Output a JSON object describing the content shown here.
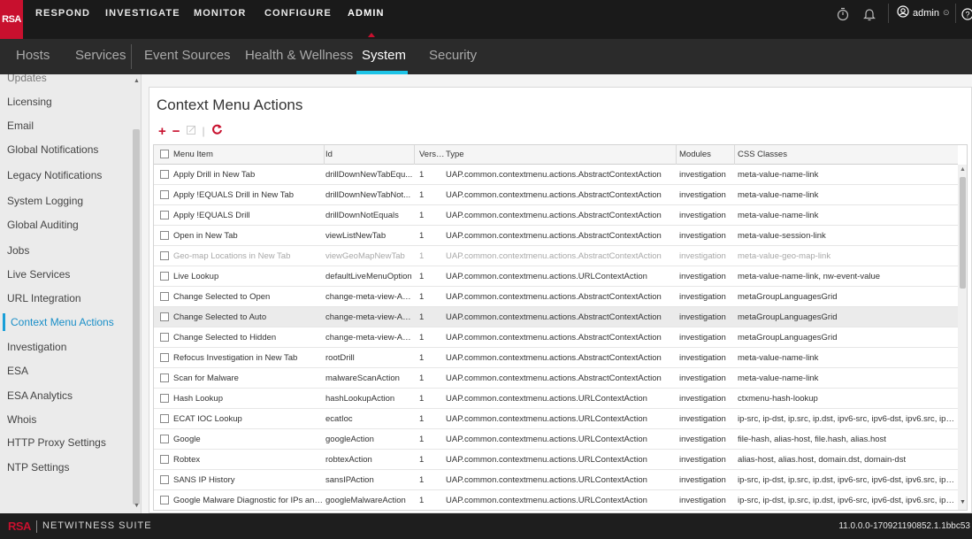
{
  "app": {
    "logo": "RSA",
    "accent": "#c8102e",
    "tab_underline_color": "#1dc3e6"
  },
  "topnav": {
    "items": [
      "RESPOND",
      "INVESTIGATE",
      "MONITOR",
      "CONFIGURE",
      "ADMIN"
    ],
    "active": "ADMIN",
    "timer_icon": "stopwatch-icon",
    "bell_icon": "bell-icon",
    "user_label": "admin",
    "help_icon": "help-icon"
  },
  "subnav": {
    "tabs": [
      "Hosts",
      "Services",
      "Event Sources",
      "Health & Wellness",
      "System",
      "Security"
    ],
    "active": "System"
  },
  "sidebar": {
    "items": [
      "Updates",
      "Licensing",
      "Email",
      "Global Notifications",
      "Legacy Notifications",
      "System Logging",
      "Global Auditing",
      "Jobs",
      "Live Services",
      "URL Integration",
      "Context Menu Actions",
      "Investigation",
      "ESA",
      "ESA Analytics",
      "Whois",
      "HTTP Proxy Settings",
      "NTP Settings"
    ],
    "active": "Context Menu Actions"
  },
  "main": {
    "title": "Context Menu Actions",
    "toolbar": {
      "add": "+",
      "remove": "−",
      "edit": "✎",
      "divider": "|",
      "refresh": "↻"
    }
  },
  "table": {
    "columns": [
      "Menu Item",
      "Id",
      "Version",
      "Type",
      "Modules",
      "CSS Classes"
    ],
    "rows": [
      {
        "name": "Apply Drill in New Tab",
        "id": "drillDownNewTabEqu...",
        "version": "1",
        "type": "UAP.common.contextmenu.actions.AbstractContextAction",
        "modules": "investigation",
        "css": "meta-value-name-link"
      },
      {
        "name": "Apply !EQUALS Drill in New Tab",
        "id": "drillDownNewTabNot...",
        "version": "1",
        "type": "UAP.common.contextmenu.actions.AbstractContextAction",
        "modules": "investigation",
        "css": "meta-value-name-link"
      },
      {
        "name": "Apply !EQUALS Drill",
        "id": "drillDownNotEquals",
        "version": "1",
        "type": "UAP.common.contextmenu.actions.AbstractContextAction",
        "modules": "investigation",
        "css": "meta-value-name-link"
      },
      {
        "name": "Open in New Tab",
        "id": "viewListNewTab",
        "version": "1",
        "type": "UAP.common.contextmenu.actions.AbstractContextAction",
        "modules": "investigation",
        "css": "meta-value-session-link"
      },
      {
        "name": "Geo-map Locations in New Tab",
        "id": "viewGeoMapNewTab",
        "version": "1",
        "type": "UAP.common.contextmenu.actions.AbstractContextAction",
        "modules": "investigation",
        "css": "meta-value-geo-map-link",
        "disabled": true
      },
      {
        "name": "Live Lookup",
        "id": "defaultLiveMenuOption",
        "version": "1",
        "type": "UAP.common.contextmenu.actions.URLContextAction",
        "modules": "investigation",
        "css": "meta-value-name-link, nw-event-value"
      },
      {
        "name": "Change Selected to Open",
        "id": "change-meta-view-AC...",
        "version": "1",
        "type": "UAP.common.contextmenu.actions.AbstractContextAction",
        "modules": "investigation",
        "css": "metaGroupLanguagesGrid"
      },
      {
        "name": "Change Selected to Auto",
        "id": "change-meta-view-AC...",
        "version": "1",
        "type": "UAP.common.contextmenu.actions.AbstractContextAction",
        "modules": "investigation",
        "css": "metaGroupLanguagesGrid",
        "selected": true
      },
      {
        "name": "Change Selected to Hidden",
        "id": "change-meta-view-AC...",
        "version": "1",
        "type": "UAP.common.contextmenu.actions.AbstractContextAction",
        "modules": "investigation",
        "css": "metaGroupLanguagesGrid"
      },
      {
        "name": "Refocus Investigation in New Tab",
        "id": "rootDrill",
        "version": "1",
        "type": "UAP.common.contextmenu.actions.AbstractContextAction",
        "modules": "investigation",
        "css": "meta-value-name-link"
      },
      {
        "name": "Scan for Malware",
        "id": "malwareScanAction",
        "version": "1",
        "type": "UAP.common.contextmenu.actions.AbstractContextAction",
        "modules": "investigation",
        "css": "meta-value-name-link"
      },
      {
        "name": "Hash Lookup",
        "id": "hashLookupAction",
        "version": "1",
        "type": "UAP.common.contextmenu.actions.URLContextAction",
        "modules": "investigation",
        "css": "ctxmenu-hash-lookup"
      },
      {
        "name": "ECAT IOC Lookup",
        "id": "ecatIoc",
        "version": "1",
        "type": "UAP.common.contextmenu.actions.URLContextAction",
        "modules": "investigation",
        "css": "ip-src, ip-dst, ip.src, ip.dst, ipv6-src, ipv6-dst, ipv6.src, ipv6.dst, ..."
      },
      {
        "name": "Google",
        "id": "googleAction",
        "version": "1",
        "type": "UAP.common.contextmenu.actions.URLContextAction",
        "modules": "investigation",
        "css": "file-hash, alias-host, file.hash, alias.host"
      },
      {
        "name": "Robtex",
        "id": "robtexAction",
        "version": "1",
        "type": "UAP.common.contextmenu.actions.URLContextAction",
        "modules": "investigation",
        "css": "alias-host, alias.host, domain.dst, domain-dst"
      },
      {
        "name": "SANS IP History",
        "id": "sansIPAction",
        "version": "1",
        "type": "UAP.common.contextmenu.actions.URLContextAction",
        "modules": "investigation",
        "css": "ip-src, ip-dst, ip.src, ip.dst, ipv6-src, ipv6-dst, ipv6.src, ipv6.dst, ..."
      },
      {
        "name": "Google Malware Diagnostic for IPs and ...",
        "id": "googleMalwareAction",
        "version": "1",
        "type": "UAP.common.contextmenu.actions.URLContextAction",
        "modules": "investigation",
        "css": "ip-src, ip-dst, ip.src, ip.dst, ipv6-src, ipv6-dst, ipv6.src, ipv6.dst, ..."
      }
    ]
  },
  "footer": {
    "brand_logo": "RSA",
    "brand_name": "NETWITNESS SUITE",
    "version": "11.0.0.0-170921190852.1.1bbc53"
  }
}
